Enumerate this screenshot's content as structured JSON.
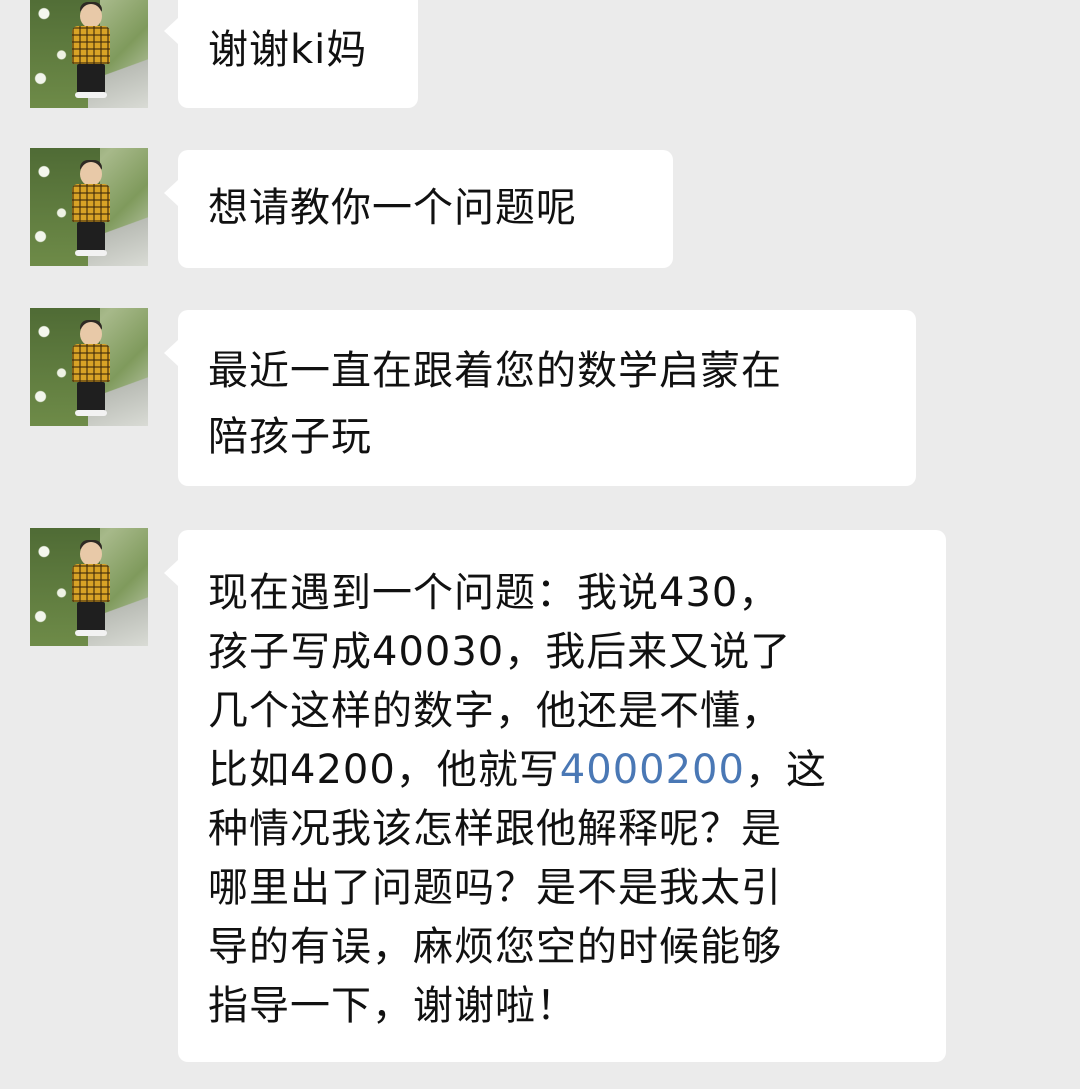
{
  "messages": [
    {
      "text": "谢谢ki妈"
    },
    {
      "text": "想请教你一个问题呢"
    },
    {
      "lines": [
        "最近一直在跟着您的数学启蒙在",
        "陪孩子玩"
      ]
    },
    {
      "line1": "现在遇到一个问题：我说430，",
      "line2": "孩子写成40030，我后来又说了",
      "line3": "几个这样的数字，他还是不懂，",
      "line4_before": "比如4200，他就写",
      "line4_link": "4000200",
      "line4_after": "，这",
      "line5": "种情况我该怎样跟他解释呢？是",
      "line6": "哪里出了问题吗？是不是我太引",
      "line7": "导的有误，麻烦您空的时候能够",
      "line8": "指导一下，谢谢啦！"
    }
  ]
}
